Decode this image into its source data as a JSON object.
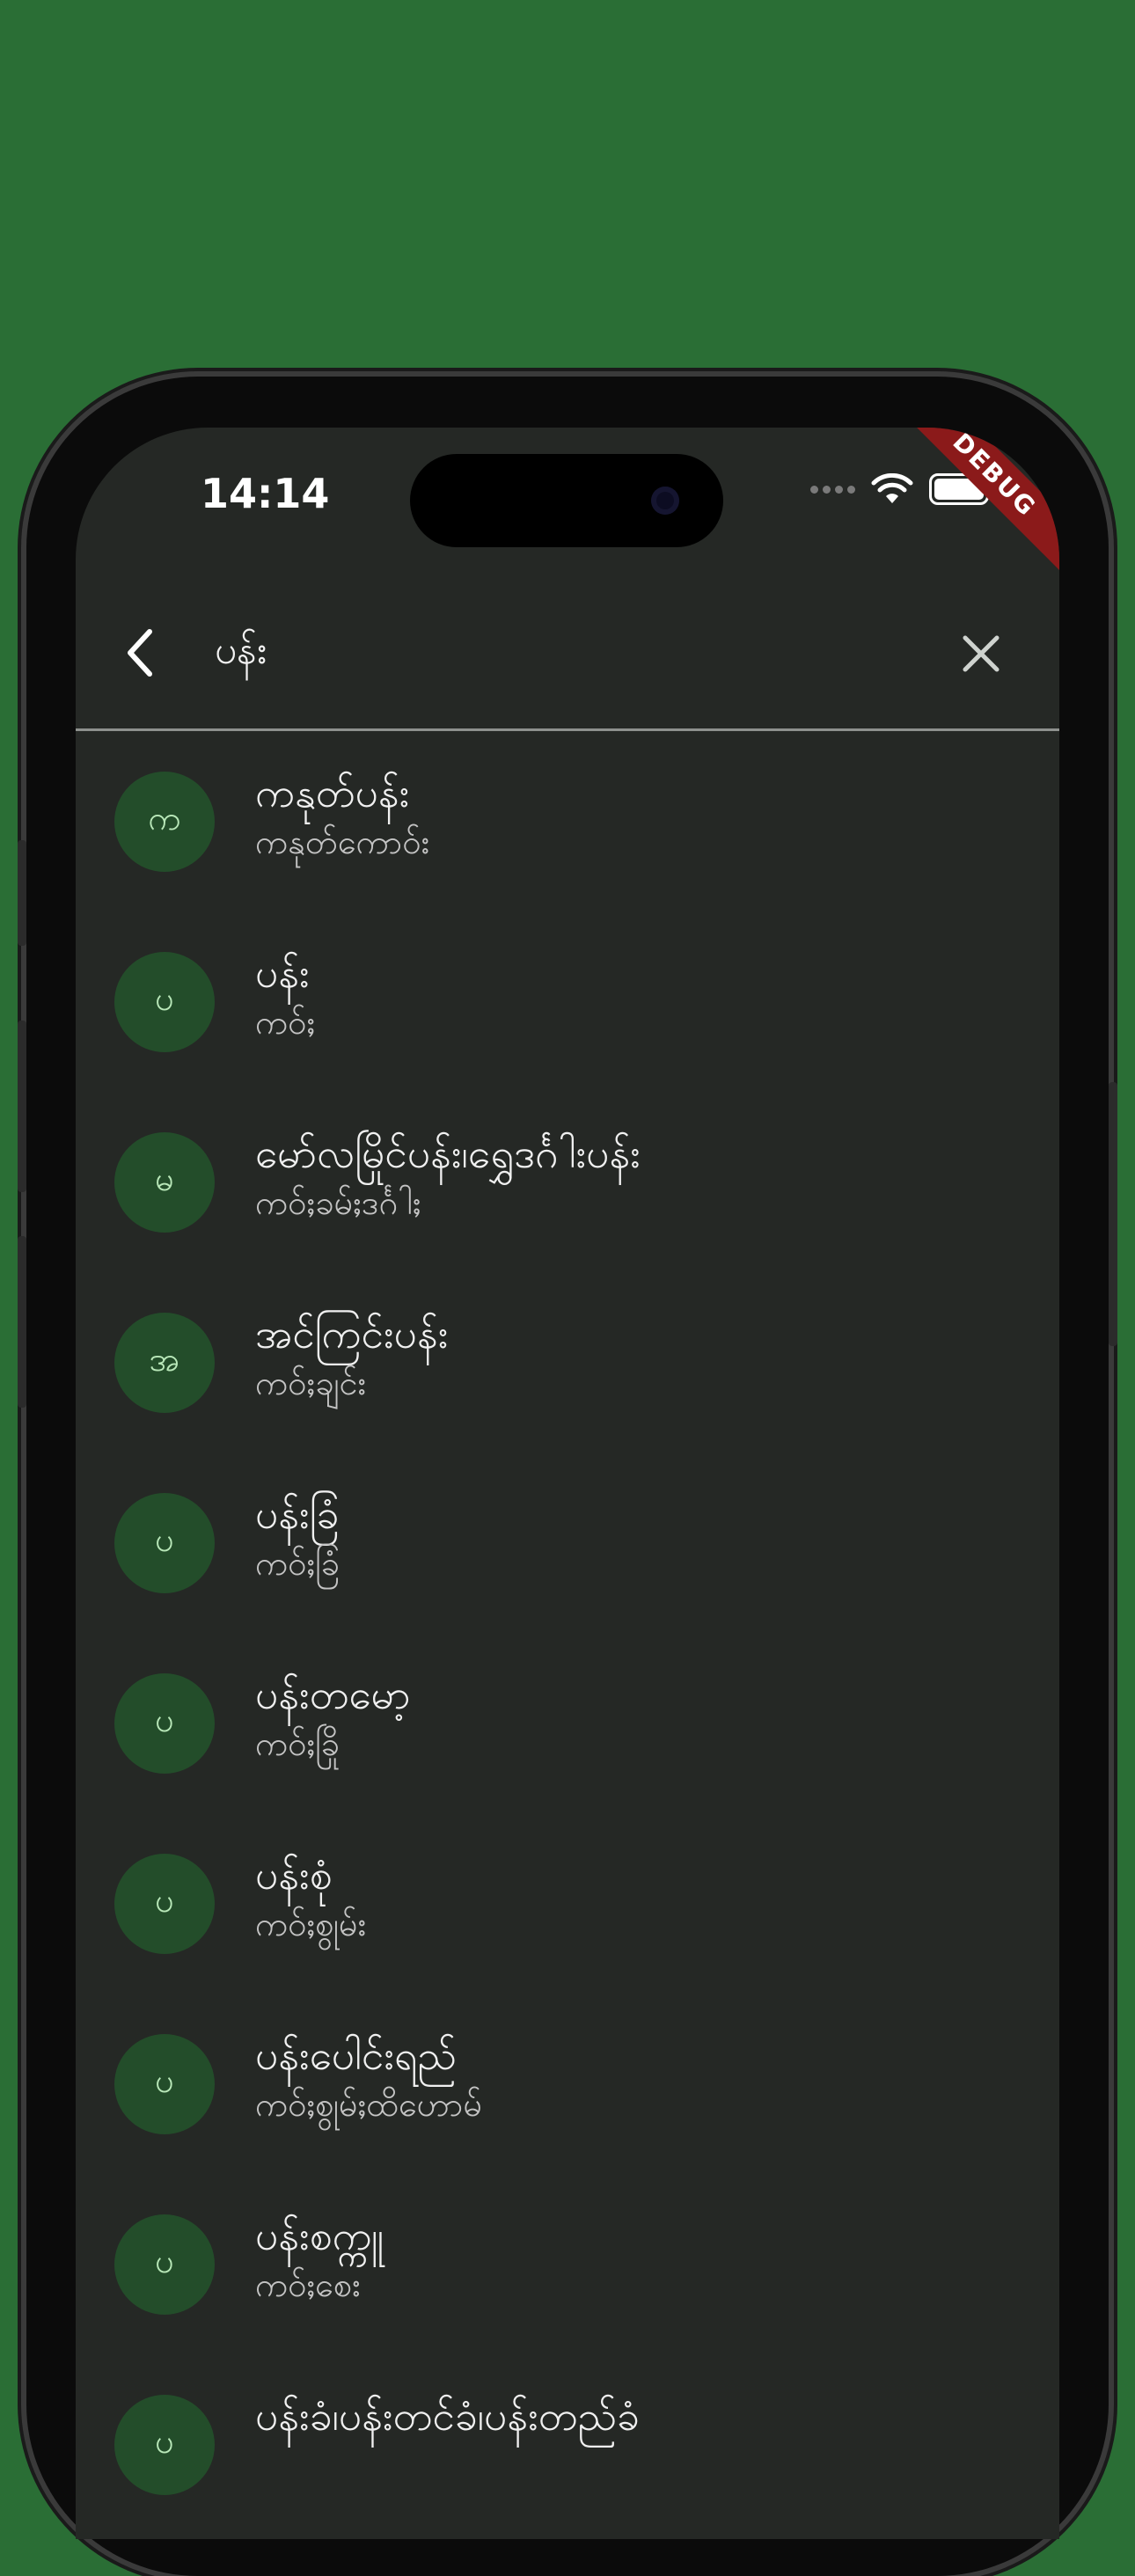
{
  "status_bar": {
    "time": "14:14",
    "icons": [
      "cellular-dots-icon",
      "wifi-icon",
      "battery-icon"
    ]
  },
  "debug_banner": "DEBUG",
  "search": {
    "query": "ပန်း",
    "back_icon": "chevron-left-icon",
    "clear_icon": "close-icon"
  },
  "results": [
    {
      "avatar": "က",
      "title": "ကနုတ်ပန်း",
      "subtitle": "ကနုတ်ကောဝ်း"
    },
    {
      "avatar": "ပ",
      "title": "ပန်း",
      "subtitle": "ကဝ်ႈ"
    },
    {
      "avatar": "မ",
      "title": "မော်လမြိုင်ပန်း၊ရွှေဒင်္ဂါးပန်း",
      "subtitle": "ကဝ်ႈခမ်ႈဒင်္ဂါႈ"
    },
    {
      "avatar": "အ",
      "title": "အင်ကြင်းပန်း",
      "subtitle": "ကဝ်ႈချင်း"
    },
    {
      "avatar": "ပ",
      "title": "ပန်းခြံ",
      "subtitle": "ကဝ်ႈခြံ"
    },
    {
      "avatar": "ပ",
      "title": "ပန်းတမော့",
      "subtitle": "ကဝ်ႈခြို"
    },
    {
      "avatar": "ပ",
      "title": "ပန်းစုံ",
      "subtitle": "ကဝ်ႈစွုမ်း"
    },
    {
      "avatar": "ပ",
      "title": "ပန်းပေါင်းရည်",
      "subtitle": "ကဝ်ႈစွုမ်ႈထိဟောမ်"
    },
    {
      "avatar": "ပ",
      "title": "ပန်းစက္ကူ",
      "subtitle": "ကဝ်ႈစေး"
    },
    {
      "avatar": "ပ",
      "title": "ပန်းခံ၊ပန်းတင်ခံ၊ပန်းတည်ခံ",
      "subtitle": ""
    }
  ],
  "colors": {
    "background": "#2a6e35",
    "screen": "#252825",
    "avatar_bg": "#234d2a",
    "avatar_text": "#b9e8b9",
    "debug": "#8b1a1a"
  }
}
